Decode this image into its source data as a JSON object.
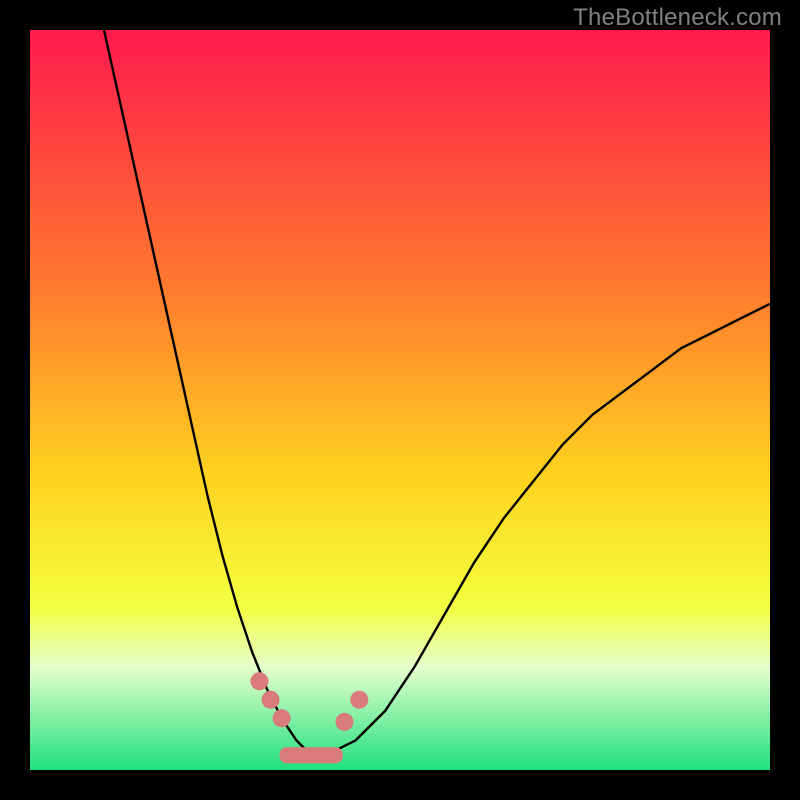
{
  "watermark": "TheBottleneck.com",
  "colors": {
    "gradient_top": "#ff1a4d",
    "gradient_q1": "#ff7a2e",
    "gradient_mid": "#ffd21f",
    "gradient_q3": "#f2ff40",
    "gradient_bot_band_top": "#e6ffcc",
    "gradient_bot": "#1fe07d",
    "frame": "#000000",
    "curve": "#000000",
    "beads": "#d97b7b",
    "pill": "#d97b7b"
  },
  "chart_data": {
    "type": "line",
    "title": "",
    "xlabel": "",
    "ylabel": "",
    "xlim": [
      0,
      100
    ],
    "ylim": [
      0,
      100
    ],
    "series": [
      {
        "name": "left-branch",
        "x": [
          10,
          12,
          14,
          16,
          18,
          20,
          22,
          24,
          26,
          28,
          30,
          32,
          34,
          36,
          38
        ],
        "values": [
          100,
          91,
          82,
          73,
          64,
          55,
          46,
          37,
          29,
          22,
          16,
          11,
          7,
          4,
          2
        ]
      },
      {
        "name": "right-branch",
        "x": [
          40,
          44,
          48,
          52,
          56,
          60,
          64,
          68,
          72,
          76,
          80,
          84,
          88,
          92,
          96,
          100
        ],
        "values": [
          2,
          4,
          8,
          14,
          21,
          28,
          34,
          39,
          44,
          48,
          51,
          54,
          57,
          59,
          61,
          63
        ]
      }
    ],
    "minimum_region": {
      "x_start": 34,
      "x_end": 42,
      "y": 2
    },
    "beads": [
      {
        "x": 31,
        "y": 12
      },
      {
        "x": 32.5,
        "y": 9.5
      },
      {
        "x": 34,
        "y": 7
      },
      {
        "x": 42.5,
        "y": 6.5
      },
      {
        "x": 44.5,
        "y": 9.5
      }
    ],
    "gradient_stops_percent": [
      0,
      35,
      60,
      78,
      86,
      100
    ]
  }
}
